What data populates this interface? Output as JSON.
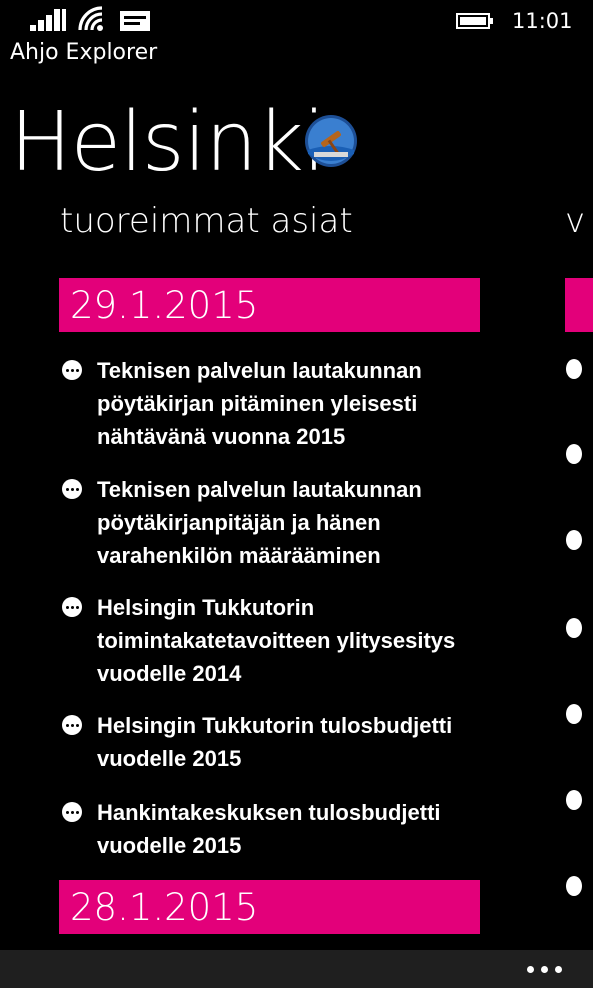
{
  "status": {
    "time": "11:01"
  },
  "app": {
    "title": "Ahjo Explorer"
  },
  "hub": {
    "title": "Helsinki",
    "logo_text": "OpenAhjo",
    "section_title": "tuoreimmat asiat",
    "next_section_title": "v"
  },
  "groups": [
    {
      "date": "29.1.2015",
      "items": [
        {
          "text": "Teknisen palvelun lautakunnan\npöytäkirjan pitäminen yleisesti\nnähtävänä vuonna 2015"
        },
        {
          "text": "Teknisen palvelun lautakunnan\npöytäkirjanpitäjän ja hänen\nvarahenkilön määrääminen"
        },
        {
          "text": "Helsingin Tukkutorin\ntoimintakatetavoitteen ylitysesitys\nvuodelle 2014"
        },
        {
          "text": "Helsingin Tukkutorin tulosbudjetti\nvuodelle 2015"
        },
        {
          "text": "Hankintakeskuksen tulosbudjetti\nvuodelle 2015"
        }
      ]
    },
    {
      "date": "28.1.2015",
      "items": []
    }
  ],
  "colors": {
    "accent": "#e3007a",
    "background": "#000000",
    "app_bar": "#1f1f1f"
  }
}
